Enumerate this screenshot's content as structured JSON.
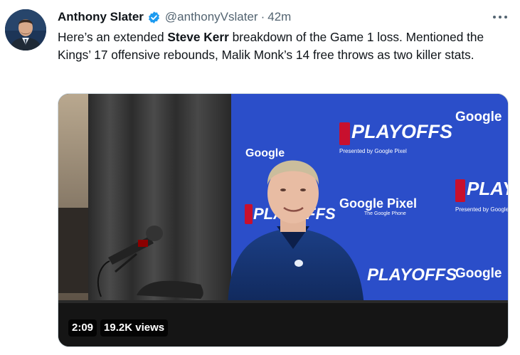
{
  "author": {
    "name": "Anthony Slater",
    "handle": "@anthonyVslater",
    "separator": "·",
    "time": "42m"
  },
  "tweet": {
    "text_before": "Here’s an extended ",
    "text_bold": "Steve Kerr",
    "text_after": " breakdown of the Game 1 loss. Mentioned the Kings’ 17 offensive rebounds, Malik Monk’s 14 free throws as two killer stats."
  },
  "video": {
    "duration": "2:09",
    "views": "19.2K views",
    "backdrop": {
      "playoffs_text": "PLAYOFFS",
      "google_pixel": "Google Pixel",
      "google": "Google",
      "presented_by": "Presented by Google Pixel",
      "the_google_phone": "The Google Phone"
    }
  },
  "colors": {
    "verified_blue": "#1d9bf0",
    "backdrop_blue": "#2b4ec9",
    "muted": "#536471"
  },
  "icons": [
    "verified-badge-icon",
    "more-options-icon"
  ]
}
